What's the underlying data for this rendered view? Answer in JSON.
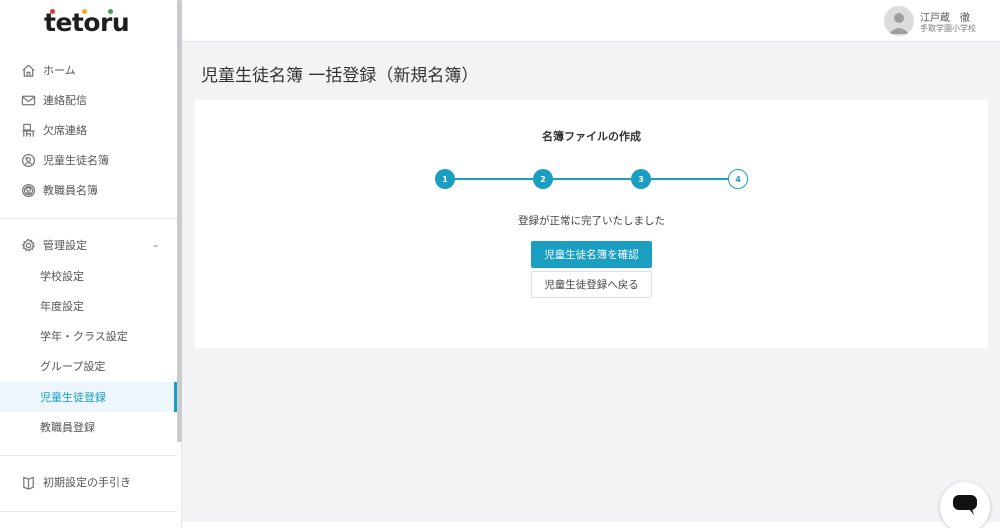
{
  "brand": {
    "logo_text": "tetoru",
    "dot_colors": [
      "#e53935",
      "#f9a825",
      "#43a047"
    ]
  },
  "sidebar": {
    "items": [
      {
        "label": "ホーム",
        "icon": "home-icon"
      },
      {
        "label": "連絡配信",
        "icon": "mail-icon"
      },
      {
        "label": "欠席連絡",
        "icon": "desk-icon"
      },
      {
        "label": "児童生徒名簿",
        "icon": "student-icon"
      },
      {
        "label": "教職員名簿",
        "icon": "staff-icon"
      }
    ],
    "settings": {
      "label": "管理設定",
      "icon": "gear-icon",
      "sub_items": [
        {
          "label": "学校設定"
        },
        {
          "label": "年度設定"
        },
        {
          "label": "学年・クラス設定"
        },
        {
          "label": "グループ設定"
        },
        {
          "label": "児童生徒登録"
        },
        {
          "label": "教職員登録"
        }
      ]
    },
    "guide": {
      "label": "初期設定の手引き",
      "icon": "book-icon"
    }
  },
  "header": {
    "user_name": "江戸蔵　徹",
    "user_school": "手取学園小学校"
  },
  "main": {
    "page_title": "児童生徒名簿 一括登録（新規名簿）",
    "card_title": "名簿ファイルの作成",
    "steps": [
      "1",
      "2",
      "3",
      "4"
    ],
    "current_step": 4,
    "message": "登録が正常に完了いたしました",
    "primary_button": "児童生徒名簿を確認",
    "secondary_button": "児童生徒登録へ戻る"
  },
  "colors": {
    "accent": "#1a9ec1",
    "background": "#f2f3f5"
  }
}
